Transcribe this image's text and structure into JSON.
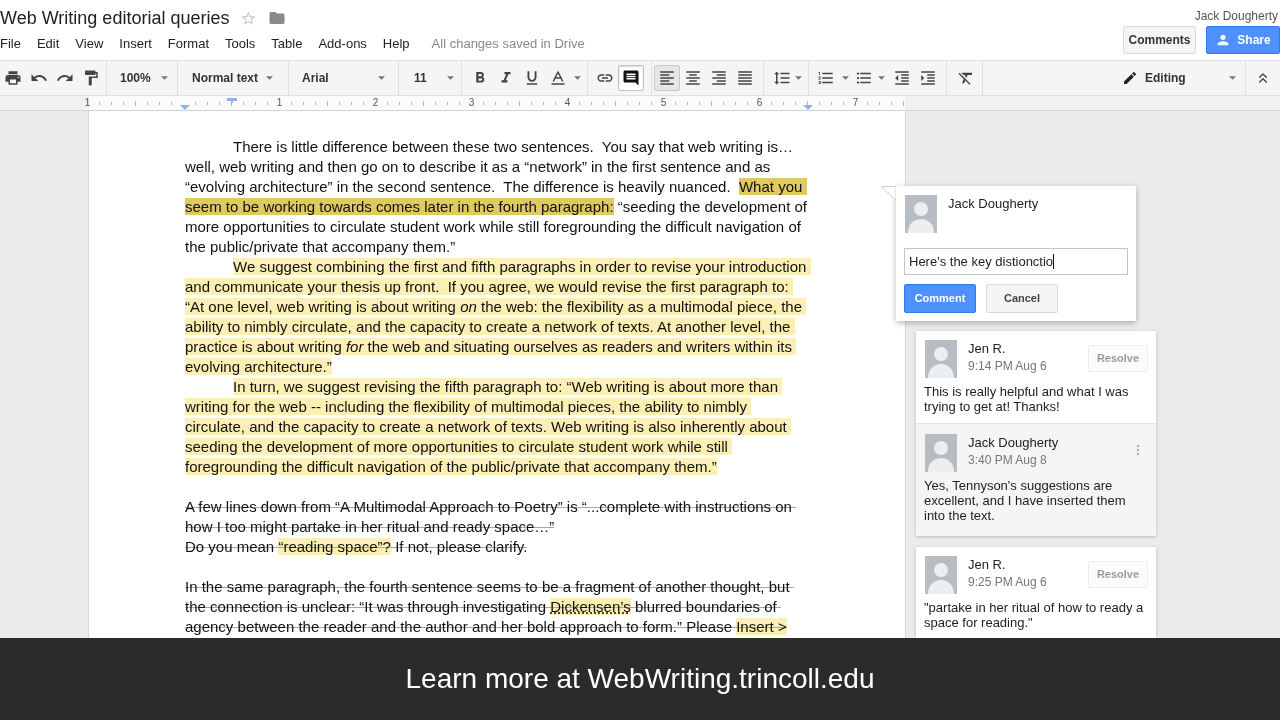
{
  "document": {
    "title": "Web Writing editorial queries",
    "starred": false
  },
  "menu": [
    "File",
    "Edit",
    "View",
    "Insert",
    "Format",
    "Tools",
    "Table",
    "Add-ons",
    "Help"
  ],
  "save_status": "All changes saved in Drive",
  "account": {
    "name": "Jack Dougherty"
  },
  "header_buttons": {
    "comments": "Comments",
    "share": "Share"
  },
  "toolbar": {
    "zoom": "100%",
    "paragraph_style": "Normal text",
    "font": "Arial",
    "font_size": "11",
    "comment_tool_active": true,
    "alignment_buttons": [
      {
        "selected": true
      },
      {
        "selected": false
      },
      {
        "selected": false
      },
      {
        "selected": false
      }
    ],
    "mode": "Editing"
  },
  "ruler": {
    "labels": [
      "1",
      "1",
      "2",
      "3",
      "4",
      "5",
      "6",
      "7"
    ]
  },
  "body": {
    "sections": [
      {
        "paragraphs": [
          {
            "indent": true,
            "struck": false,
            "runs": [
              {
                "text": "There is little difference between these two sentences.  You say that web writing is… well, web writing and then go on to describe it as a “network” in the first sentence and as “evolving architecture” in the second sentence.  The difference is heavily nuanced.  ",
                "misspelled": false
              },
              {
                "text": "What you seem to be working towards comes later in the fourth paragraph:",
                "color": "#e0c862",
                "misspelled": false
              },
              {
                "text": " “seeding the development of more opportunities to circulate student work while still foregrounding the difficult navigation of the public/private that accompany them.”",
                "misspelled": false
              }
            ]
          },
          {
            "indent": true,
            "struck": false,
            "runs": [
              {
                "text": "We suggest combining the first and fifth paragraphs in order to revise your introduction and communicate your thesis up front.  If you agree, we would revise the first paragraph to: “At one level, web writing is about writing *on* the web: the flexibility as a multimodal piece, the ability to nimbly circulate, and the capacity to create a network of texts. At another level, the practice is about writing *for* the web and situating ourselves as readers and writers within its evolving architecture.”",
                "color": "#fcefb4",
                "misspelled": false
              }
            ]
          },
          {
            "indent": true,
            "struck": false,
            "runs": [
              {
                "text": "In turn, we suggest revising the fifth paragraph to: “Web writing is about more than writing for the web -- including the flexibility of multimodal pieces, the ability to nimbly circulate, and the capacity to create a network of texts. Web writing is also inherently about seeding the development of more opportunities to circulate student work while still foregrounding the difficult navigation of the public/private that accompany them.”",
                "color": "#fcefb4",
                "misspelled": false
              }
            ]
          }
        ]
      },
      {
        "paragraphs": [
          {
            "indent": false,
            "struck": true,
            "runs": [
              {
                "text": "A few lines down from “A Multimodal Approach to Poetry” is “...complete with instructions on how I too might partake in her ritual and ready space…”",
                "misspelled": false
              }
            ]
          },
          {
            "indent": false,
            "struck": true,
            "runs": [
              {
                "text": "Do you mean ",
                "misspelled": false
              },
              {
                "text": "“reading space”?",
                "color": "#fcefb4",
                "misspelled": false
              },
              {
                "text": " If not, please clarify.",
                "misspelled": false
              }
            ]
          }
        ]
      },
      {
        "paragraphs": [
          {
            "indent": false,
            "struck": true,
            "runs": [
              {
                "text": "In the same paragraph, the fourth sentence seems to be a fragment of another thought, but the connection is unclear: “It was through investigating ",
                "misspelled": false
              },
              {
                "text": "Dickensen’s",
                "color": "#fcefb4",
                "misspelled": true
              },
              {
                "text": " blurred boundaries of agency between the reader and the author and her bold approach to form.” Please ",
                "misspelled": false
              },
              {
                "text": "Insert >",
                "color": "#fcefb4",
                "misspelled": false
              }
            ]
          }
        ]
      }
    ]
  },
  "comment_draft": {
    "author": "Jack Dougherty",
    "value": "Here's the key distionctio",
    "submit": "Comment",
    "cancel": "Cancel"
  },
  "threads": [
    {
      "author": "Jen R.",
      "time": "9:14 PM Aug 6",
      "resolve": "Resolve",
      "text": "This is really helpful and what I was trying to get at! Thanks!",
      "replies": [
        {
          "author": "Jack Dougherty",
          "time": "3:40 PM Aug 8",
          "text": "Yes, Tennyson's suggestions are excellent, and I have inserted them into the text."
        }
      ]
    },
    {
      "author": "Jen R.",
      "time": "9:25 PM Aug 6",
      "resolve": "Resolve",
      "text": "\"partake in her ritual of how to ready a space for reading.\""
    }
  ],
  "banner": {
    "text": "Learn more at WebWriting.trincoll.edu"
  }
}
